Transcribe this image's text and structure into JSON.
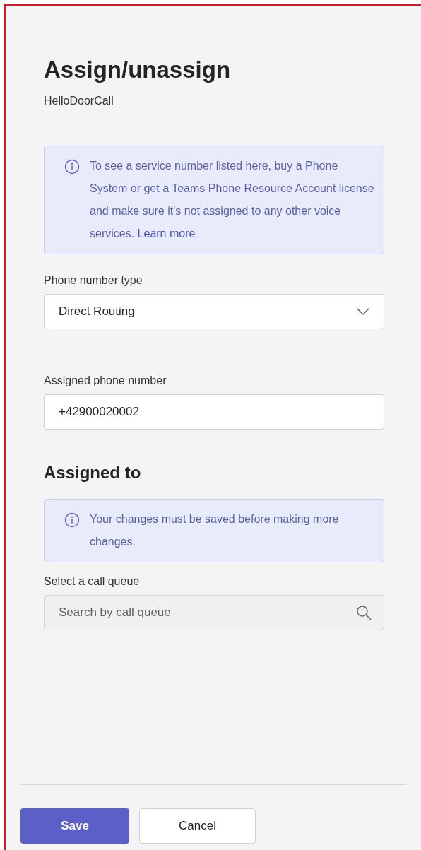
{
  "panel": {
    "title": "Assign/unassign",
    "subtitle": "HelloDoorCall"
  },
  "notice": {
    "text": "To see a service number listed here, buy a Phone System or get a Teams Phone Resource Account license and make sure it's not assigned to any other voice services.",
    "link": "Learn more"
  },
  "fields": [
    {
      "kind": "select",
      "label": "Phone number type",
      "value": "Direct Routing"
    },
    {
      "kind": "text",
      "label": "Assigned phone number",
      "value": "+42900020002"
    }
  ],
  "assigned_to": {
    "heading": "Assigned to",
    "notice": "Your changes must be saved before making more changes.",
    "label": "Select a call queue",
    "search": {
      "placeholder": "Search by call queue",
      "disabled": true
    }
  },
  "buttons": [
    {
      "kind": "primary",
      "label": "Save"
    },
    {
      "kind": "secondary",
      "label": "Cancel"
    }
  ]
}
